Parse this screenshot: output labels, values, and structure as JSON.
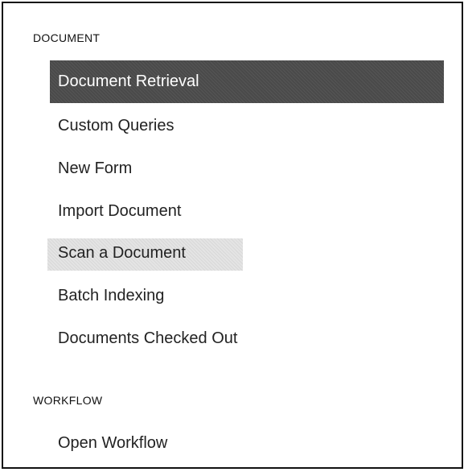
{
  "sections": [
    {
      "header": "DOCUMENT",
      "items": [
        {
          "label": "Document Retrieval",
          "state": "selected"
        },
        {
          "label": "Custom Queries",
          "state": "normal"
        },
        {
          "label": "New Form",
          "state": "normal"
        },
        {
          "label": "Import Document",
          "state": "normal"
        },
        {
          "label": "Scan a Document",
          "state": "hover"
        },
        {
          "label": "Batch Indexing",
          "state": "normal"
        },
        {
          "label": "Documents Checked Out",
          "state": "normal"
        }
      ]
    },
    {
      "header": "WORKFLOW",
      "items": [
        {
          "label": "Open Workflow",
          "state": "normal"
        }
      ]
    }
  ],
  "colors": {
    "selected_bg": "#4a4a4a",
    "hover_bg": "#e4e4e4",
    "border": "#111111"
  }
}
